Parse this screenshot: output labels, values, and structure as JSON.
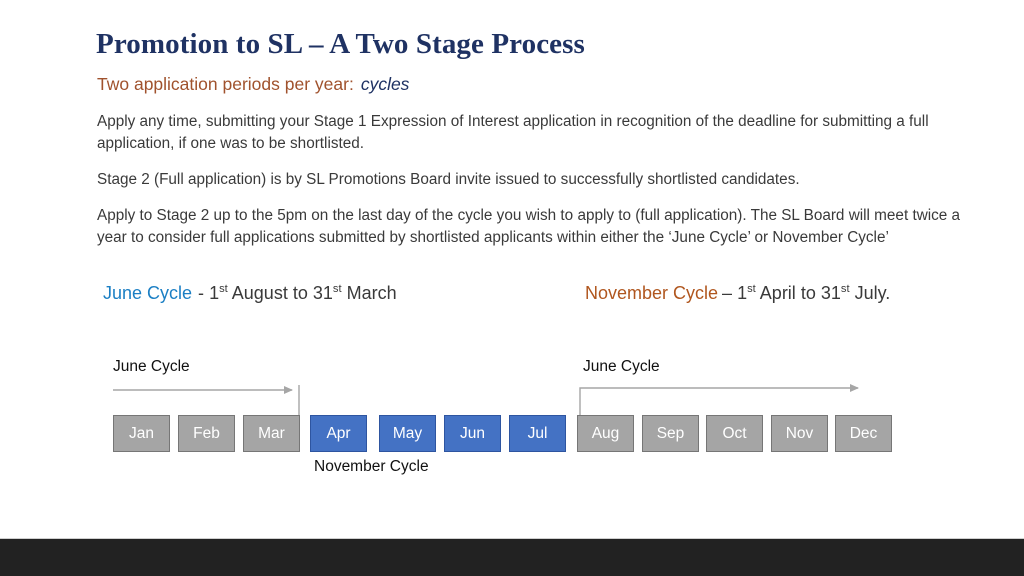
{
  "slide": {
    "title": "Promotion to SL – A Two Stage Process",
    "subtitle": {
      "lead": "Two application periods per year:",
      "accent": "cycles"
    },
    "paragraphs": [
      "Apply any time, submitting your Stage 1 Expression of Interest application in recognition of the deadline for submitting a full application, if one was to be shortlisted.",
      "Stage 2 (Full application) is by SL Promotions Board invite issued to successfully shortlisted candidates.",
      "Apply to Stage 2 up to the 5pm on the last day of the cycle you wish to apply to (full application). The SL Board will meet twice a year to consider full applications submitted by shortlisted applicants within either the ‘June Cycle’ or November Cycle’"
    ],
    "cycle_definitions": [
      {
        "name": "June Cycle",
        "dash": "-",
        "start_num": "1",
        "start_sup": "st",
        "start_month": "August",
        "joiner": "to",
        "end_num": "31",
        "end_sup": "st",
        "end_month": "March",
        "color": "#1B7FC4"
      },
      {
        "name": "November Cycle",
        "dash": "–",
        "start_num": "1",
        "start_sup": "st",
        "start_month": "April",
        "joiner": "to",
        "end_num": "31",
        "end_sup": "st",
        "end_month": "July.",
        "color": "#B0561E"
      }
    ],
    "timeline": {
      "label_june_left": "June Cycle",
      "label_june_right": "June Cycle",
      "label_november": "November  Cycle",
      "months": [
        {
          "label": "Jan",
          "highlight": false
        },
        {
          "label": "Feb",
          "highlight": false
        },
        {
          "label": "Mar",
          "highlight": false
        },
        {
          "label": "Apr",
          "highlight": true
        },
        {
          "label": "May",
          "highlight": true
        },
        {
          "label": "Jun",
          "highlight": true
        },
        {
          "label": "Jul",
          "highlight": true
        },
        {
          "label": "Aug",
          "highlight": false
        },
        {
          "label": "Sep",
          "highlight": false
        },
        {
          "label": "Oct",
          "highlight": false
        },
        {
          "label": "Nov",
          "highlight": false
        },
        {
          "label": "Dec",
          "highlight": false
        }
      ],
      "colors": {
        "grey_fill": "#A5A5A5",
        "grey_border": "#767676",
        "blue_fill": "#4472C4",
        "blue_border": "#2E55A0",
        "arrow": "#A6A6A6"
      }
    },
    "colors": {
      "title": "#1F3263",
      "subtitle": "#A0522D",
      "accent_navy": "#1F3263",
      "body": "#3A3A3A",
      "footer_bar": "#222222"
    }
  }
}
